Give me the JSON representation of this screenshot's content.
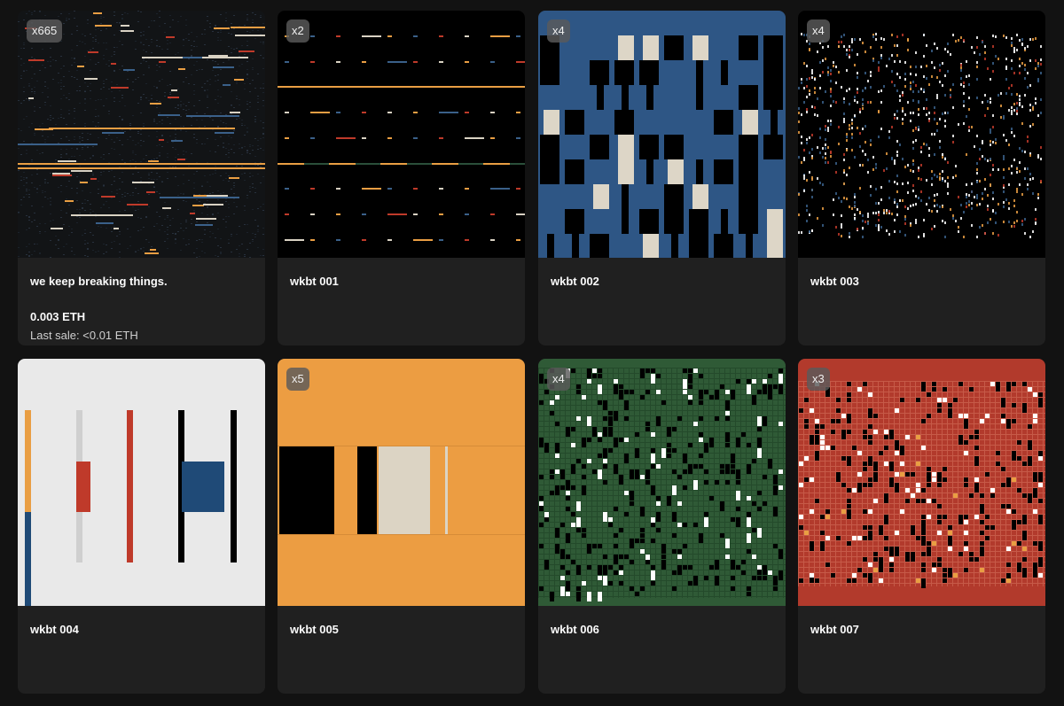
{
  "collection": {
    "items": [
      {
        "title": "we keep breaking things.",
        "edition_badge": "x665",
        "price": "0.003 ETH",
        "last_sale": "Last sale: <0.01 ETH",
        "art_palette": {
          "background": "#121416",
          "accent": [
            "#e99e43",
            "#3a6089",
            "#d9d2c3"
          ]
        }
      },
      {
        "title": "wkbt 001",
        "edition_badge": "x2",
        "art_palette": {
          "background": "#000000",
          "accent": [
            "#e99e43",
            "#3a6089",
            "#bf3a2a"
          ]
        }
      },
      {
        "title": "wkbt 002",
        "edition_badge": "x4",
        "art_palette": {
          "background": "#2e5685",
          "accent": [
            "#000000",
            "#ddd6c7"
          ]
        }
      },
      {
        "title": "wkbt 003",
        "edition_badge": "x4",
        "art_palette": {
          "background": "#000000",
          "accent": [
            "#ffffff",
            "#e99e43",
            "#3a6089",
            "#bf3a2a"
          ]
        }
      },
      {
        "title": "wkbt 004",
        "art_palette": {
          "background": "#e9e9e9",
          "accent": [
            "#e99e43",
            "#1f4a77",
            "#bf3a2a",
            "#000000"
          ]
        }
      },
      {
        "title": "wkbt 005",
        "edition_badge": "x5",
        "art_palette": {
          "background": "#ec9d42",
          "accent": [
            "#000000",
            "#dcd4c4"
          ]
        }
      },
      {
        "title": "wkbt 006",
        "edition_badge": "x4",
        "art_palette": {
          "background": "#2f5a36",
          "accent": [
            "#000000",
            "#ffffff"
          ]
        }
      },
      {
        "title": "wkbt 007",
        "edition_badge": "x3",
        "art_palette": {
          "background": "#b23a2c",
          "accent": [
            "#000000",
            "#ffffff",
            "#e99e43"
          ]
        }
      }
    ]
  }
}
